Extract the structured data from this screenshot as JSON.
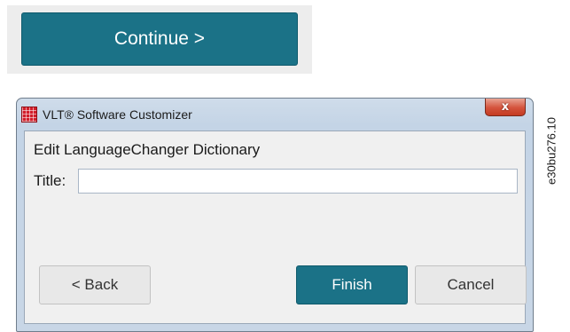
{
  "continue_button": {
    "label": "Continue >"
  },
  "window": {
    "title": "VLT® Software Customizer",
    "close_label": "x",
    "heading": "Edit LanguageChanger Dictionary",
    "title_field": {
      "label": "Title:",
      "value": "",
      "placeholder": ""
    },
    "buttons": {
      "back": "< Back",
      "finish": "Finish",
      "cancel": "Cancel"
    }
  },
  "figure_ref": "e30bu276.10",
  "colors": {
    "accent": "#1b7287",
    "close_red": "#c43b22",
    "app_icon_red": "#d21d2a"
  },
  "icons": {
    "app": "vlt-app-icon",
    "close": "close-icon"
  }
}
